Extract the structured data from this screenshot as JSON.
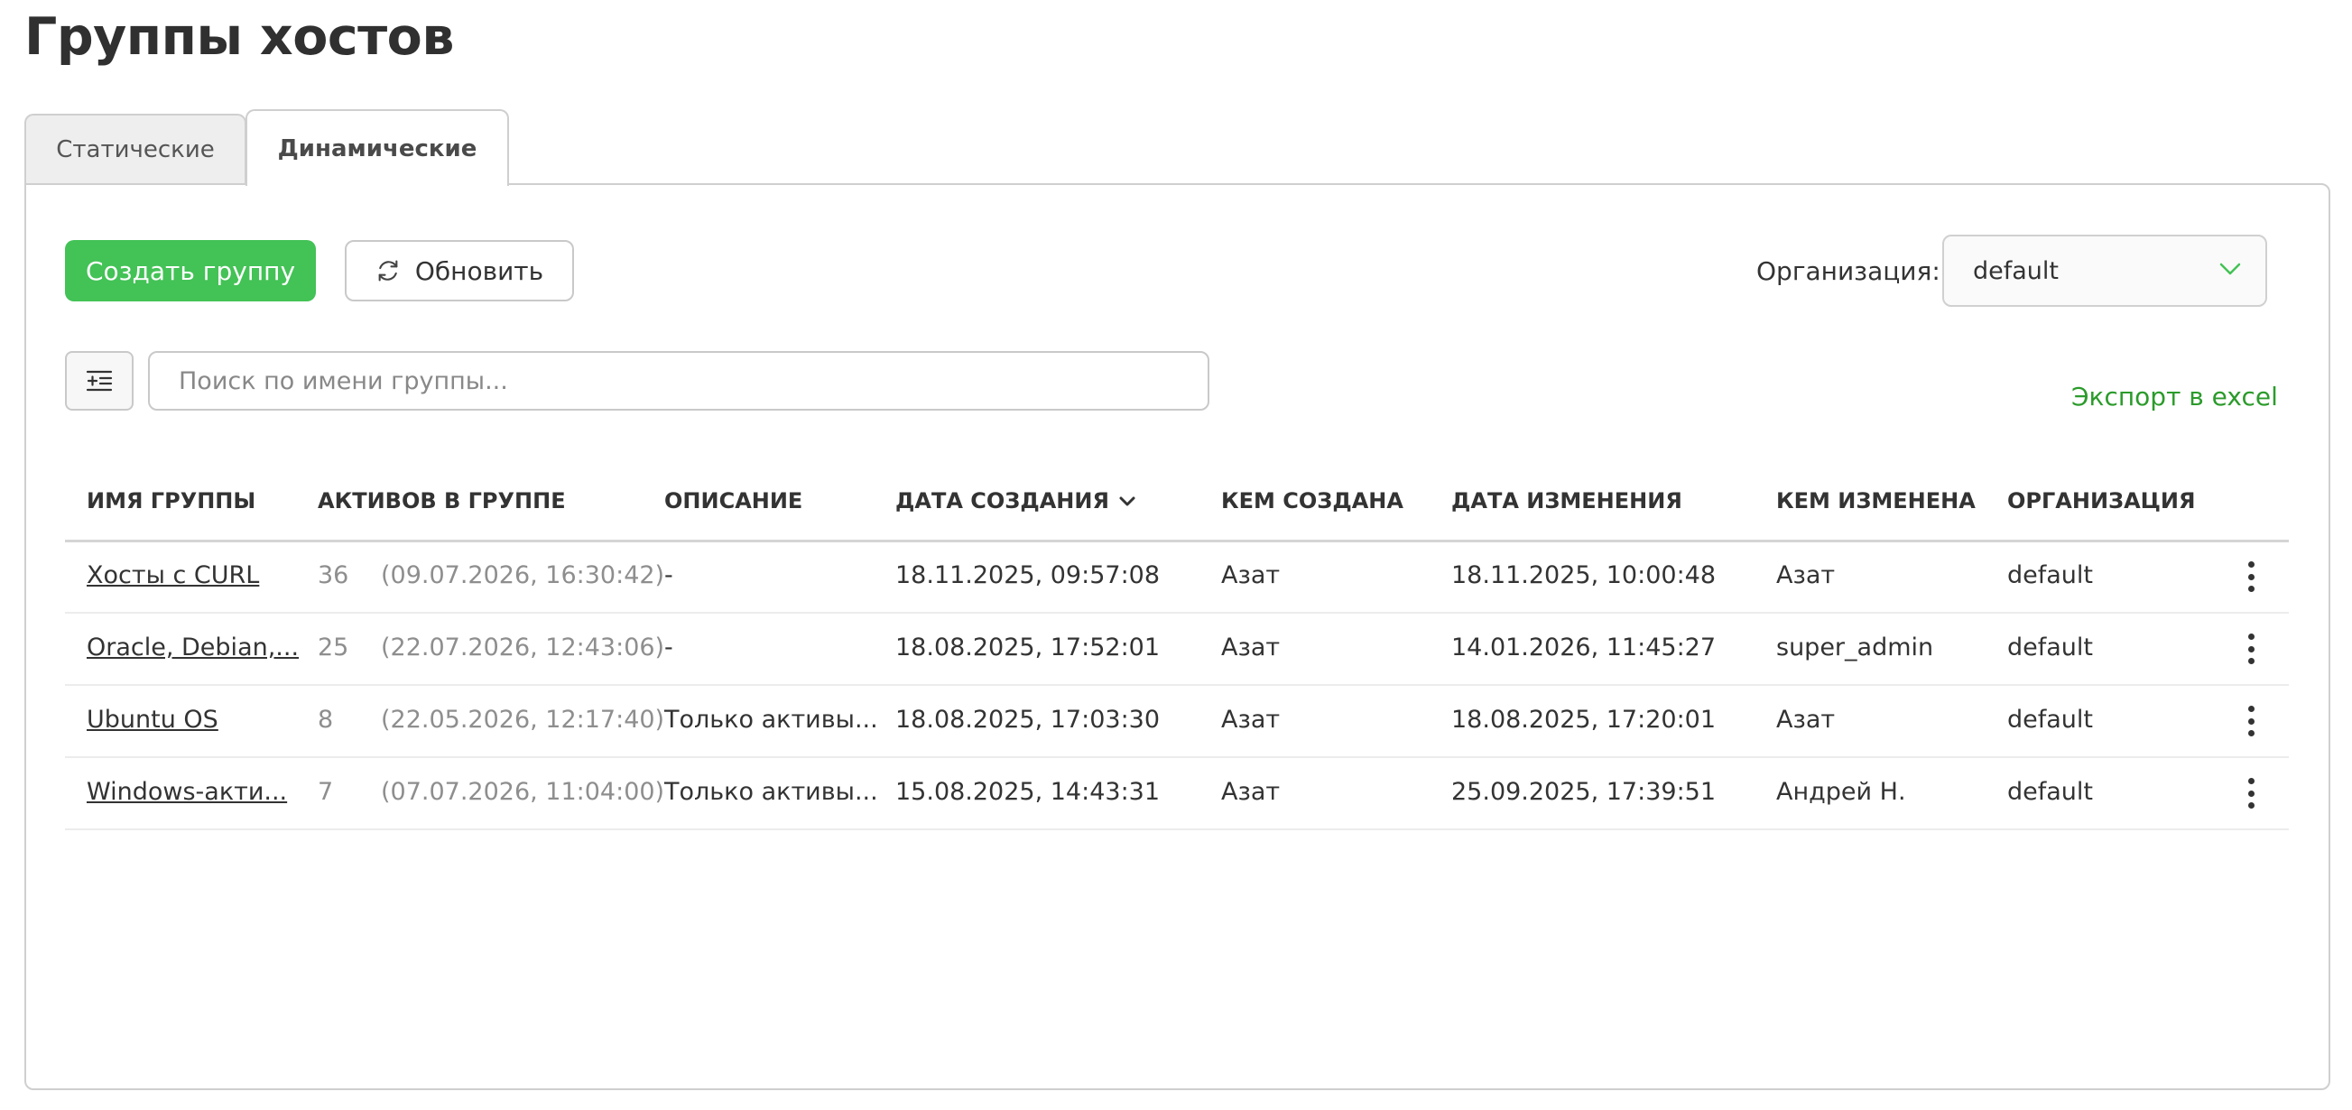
{
  "page": {
    "title": "Группы хостов"
  },
  "tabs": [
    {
      "label": "Статические",
      "active": false
    },
    {
      "label": "Динамические",
      "active": true
    }
  ],
  "toolbar": {
    "create_label": "Создать группу",
    "refresh_label": "Обновить",
    "org_label": "Организация:",
    "org_value": "default",
    "search_placeholder": "Поиск по имени группы...",
    "export_label": "Экспорт в excel"
  },
  "table": {
    "columns": [
      "ИМЯ ГРУППЫ",
      "АКТИВОВ В ГРУППЕ",
      "ОПИСАНИЕ",
      "ДАТА СОЗДАНИЯ",
      "КЕМ СОЗДАНА",
      "ДАТА ИЗМЕНЕНИЯ",
      "КЕМ ИЗМЕНЕНА",
      "ОРГАНИЗАЦИЯ"
    ],
    "rows": [
      {
        "name": "Хосты с CURL",
        "count": "36",
        "count_date": "(09.07.2026, 16:30:42)",
        "description": "-",
        "created": "18.11.2025, 09:57:08",
        "created_by": "Азат",
        "modified": "18.11.2025, 10:00:48",
        "modified_by": "Азат",
        "org": "default"
      },
      {
        "name": "Oracle, Debian,...",
        "count": "25",
        "count_date": "(22.07.2026, 12:43:06)",
        "description": "-",
        "created": "18.08.2025, 17:52:01",
        "created_by": "Азат",
        "modified": "14.01.2026, 11:45:27",
        "modified_by": "super_admin",
        "org": "default"
      },
      {
        "name": "Ubuntu OS",
        "count": "8",
        "count_date": "(22.05.2026, 12:17:40)",
        "description": "Только активы...",
        "created": "18.08.2025, 17:03:30",
        "created_by": "Азат",
        "modified": "18.08.2025, 17:20:01",
        "modified_by": "Азат",
        "org": "default"
      },
      {
        "name": "Windows-акти...",
        "count": "7",
        "count_date": "(07.07.2026, 11:04:00)",
        "description": "Только активы...",
        "created": "15.08.2025, 14:43:31",
        "created_by": "Азат",
        "modified": "25.09.2025, 17:39:51",
        "modified_by": "Андрей Н.",
        "org": "default"
      }
    ]
  },
  "colors": {
    "accent": "#43c256",
    "export_link": "#2b9b2b"
  }
}
